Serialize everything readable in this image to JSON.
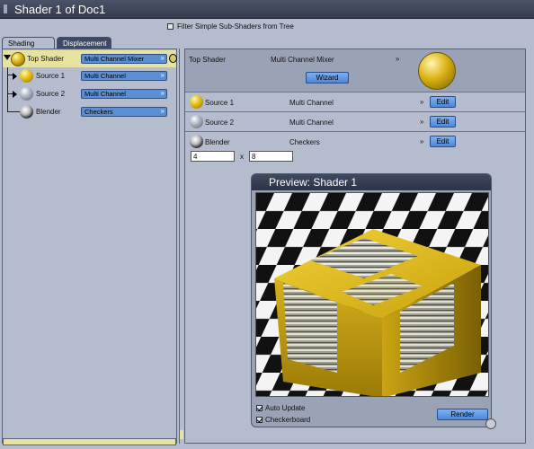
{
  "window": {
    "title": "Shader 1 of Doc1"
  },
  "filter": {
    "label": "Filter Simple Sub-Shaders from Tree",
    "checked": false
  },
  "tabs": [
    {
      "label": "Shading",
      "active": true
    },
    {
      "label": "Displacement",
      "active": false
    }
  ],
  "tree": {
    "items": [
      {
        "label": "Top Shader",
        "shader": "Multi Channel Mixer",
        "icon": "cage-ball-icon",
        "selected": true
      },
      {
        "label": "Source 1",
        "shader": "Multi Channel",
        "icon": "gold-ball-icon"
      },
      {
        "label": "Source 2",
        "shader": "Multi Channel",
        "icon": "grey-ball-icon"
      },
      {
        "label": "Blender",
        "shader": "Checkers",
        "icon": "checker-ball-icon"
      }
    ]
  },
  "detail": {
    "top": {
      "label": "Top Shader",
      "shader": "Multi Channel Mixer",
      "wizard_label": "Wizard"
    },
    "rows": [
      {
        "label": "Source 1",
        "shader": "Multi Channel",
        "edit_label": "Edit"
      },
      {
        "label": "Source 2",
        "shader": "Multi Channel",
        "edit_label": "Edit"
      },
      {
        "label": "Blender",
        "shader": "Checkers",
        "edit_label": "Edit"
      }
    ],
    "size_x": "4",
    "size_sep": "x",
    "size_y": "8"
  },
  "preview": {
    "title": "Preview: Shader 1",
    "auto_update": {
      "label": "Auto Update",
      "checked": true
    },
    "checkerboard": {
      "label": "Checkerboard",
      "checked": true
    },
    "render_label": "Render"
  },
  "colors": {
    "accent": "#5b8ed3",
    "selection": "#e6e2a0",
    "titlebar": "#3a4255"
  }
}
